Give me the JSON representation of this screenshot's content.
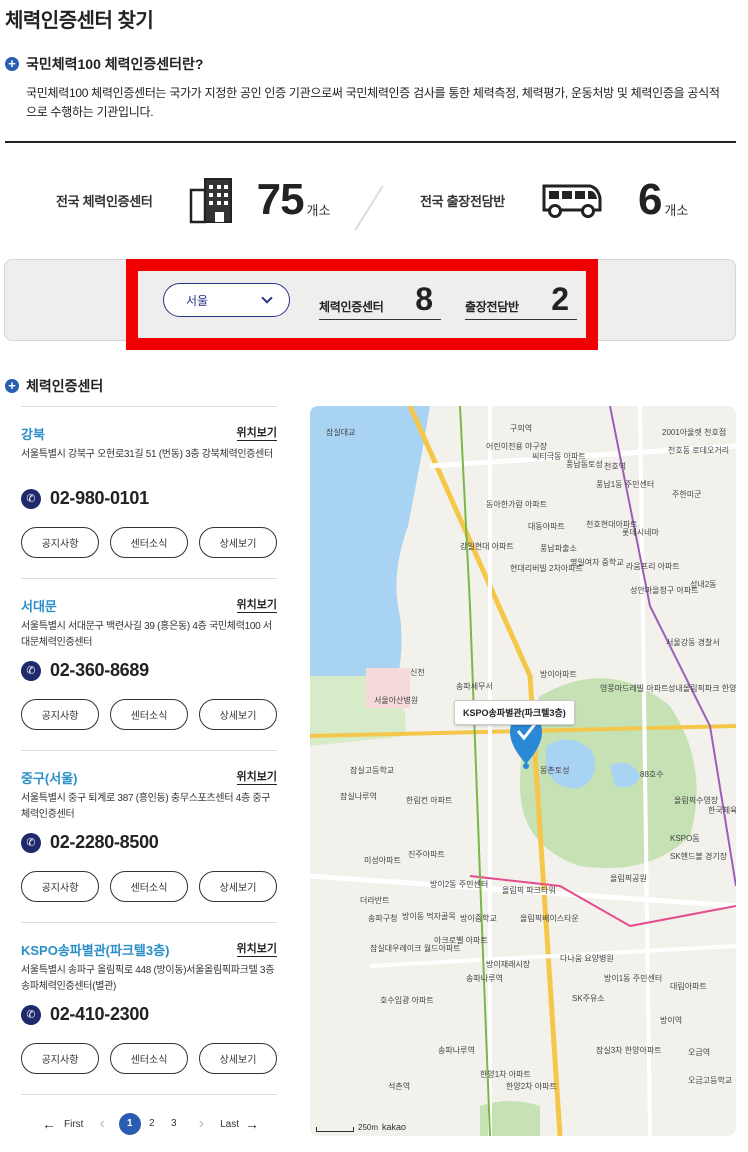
{
  "page": {
    "title": "체력인증센터 찾기"
  },
  "intro": {
    "title": "국민체력100 체력인증센터란?",
    "description": "국민체력100 체력인증센터는 국가가 지정한 공인 인증 기관으로써 국민체력인증 검사를 통한 체력측정, 체력평가, 운동처방 및 체력인증을 공식적으로 수행하는 기관입니다."
  },
  "stats": {
    "centers": {
      "label": "전국 체력인증센터",
      "count": "75",
      "unit": "개소",
      "icon": "building-icon"
    },
    "mobile": {
      "label": "전국 출장전담반",
      "count": "6",
      "unit": "개소",
      "icon": "van-icon"
    }
  },
  "filter": {
    "region": "서울",
    "center_label": "체력인증센터",
    "center_count": "8",
    "mobile_label": "출장전담반",
    "mobile_count": "2",
    "highlight_color": "#f00000"
  },
  "list": {
    "title": "체력인증센터",
    "location_label": "위치보기",
    "buttons": {
      "notice": "공지사항",
      "news": "센터소식",
      "detail": "상세보기"
    },
    "items": [
      {
        "name": "강북",
        "address": "서울특별시 강북구 오현로31길 51 (번동) 3층 강북체력인증센터",
        "phone": "02-980-0101"
      },
      {
        "name": "서대문",
        "address": "서울특별시 서대문구 백련사길 39 (홍은동) 4층 국민체력100 서대문체력인증센터",
        "phone": "02-360-8689"
      },
      {
        "name": "중구(서울)",
        "address": "서울특별시 중구 퇴계로 387 (흥인동) 충무스포츠센터 4층 중구 체력인증센터",
        "phone": "02-2280-8500"
      },
      {
        "name": "KSPO송파별관(파크텔3층)",
        "address": "서울특별시 송파구 올림픽로 448 (방이동)서울올림픽파크텔 3층 송파체력인증센터(별관)",
        "phone": "02-410-2300"
      }
    ]
  },
  "pagination": {
    "first": "First",
    "last": "Last",
    "pages": [
      "1",
      "2",
      "3"
    ],
    "current": "1"
  },
  "map": {
    "callout": "KSPO송파별관(파크텔3층)",
    "scale": "250m",
    "provider": "kakao",
    "labels": [
      "구의역",
      "어린이전용 야구장",
      "씨티극동 아파트",
      "풍납동토성",
      "천호역",
      "천호동 로데오거리",
      "2001아울렛 천호점",
      "잠실대교",
      "풍납1동 주민센터",
      "주한미군",
      "동아한가람 아파트",
      "대동아파트",
      "천호현대아파트",
      "롯데시네마",
      "강일현대 아파트",
      "풍납파출소",
      "현대리버빌 2차아파트",
      "명일여자 중학교",
      "라움프리 아파트",
      "성내2동",
      "성안마을청구 아파트",
      "서울아산병원",
      "신천",
      "송파세무서",
      "방이아파트",
      "영풍마드레빌 아파트",
      "서울강동 경찰서",
      "성내올림픽파크 한양수자인아파트",
      "잠실고등학교",
      "잠실나루역",
      "몽촌토성",
      "88호수",
      "올림픽수영장",
      "한국체육 대학교",
      "KSPO돔",
      "SK핸드볼 경기장",
      "올림픽공원",
      "진주아파트",
      "미성아파트",
      "방이2동 주민센터",
      "올림픽 파크타워",
      "한림컨 아파트",
      "올림픽베이스타운",
      "방이중학교",
      "더라반트",
      "송파구청",
      "방이동 먹자골목",
      "아크로벨 아파트",
      "잠실대우레이크 월드아파트",
      "송파나루역",
      "방이재래시장",
      "다나움 요양병원",
      "방이1동 주민센터",
      "SK주유소",
      "방이역",
      "대림아파트",
      "호수임광 아파트",
      "송파나루역",
      "석촌역",
      "한양1차 아파트",
      "한양2차 아파트",
      "잠실3차 한양아파트",
      "오금역",
      "오금고등학교"
    ]
  }
}
